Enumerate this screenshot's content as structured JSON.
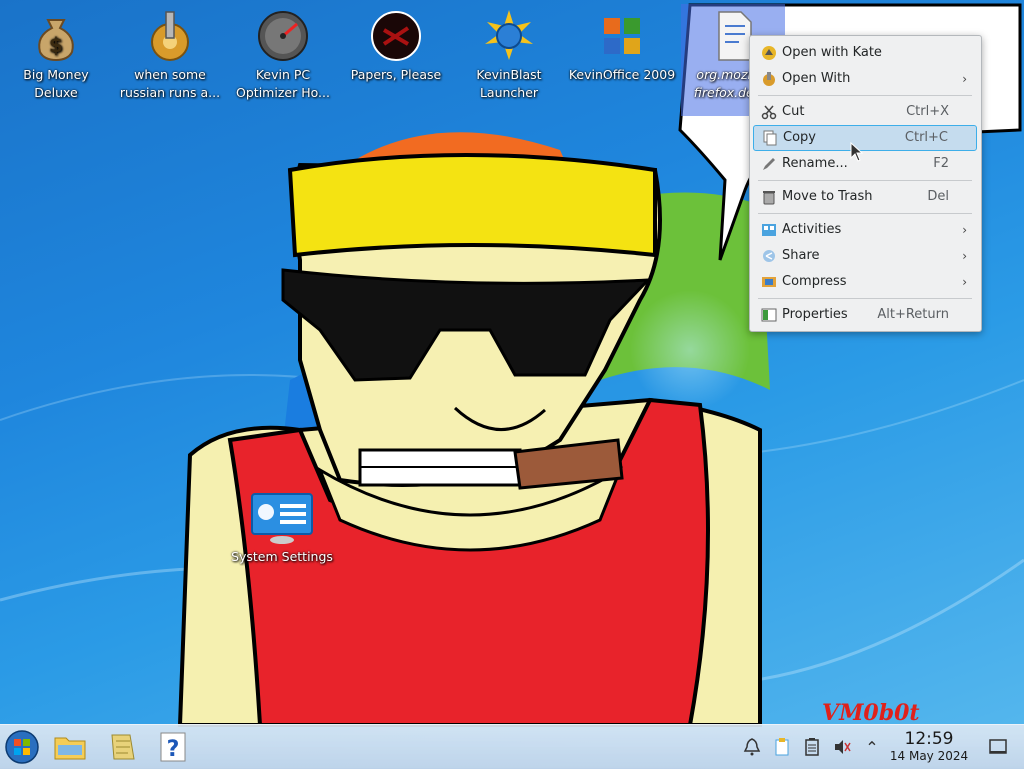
{
  "desktop": {
    "icons": [
      {
        "name": "big-money-deluxe",
        "label": "Big Money Deluxe"
      },
      {
        "name": "russian-runs",
        "label": "when some russian runs a..."
      },
      {
        "name": "kevin-pc-optimizer",
        "label": "Kevin PC Optimizer Ho..."
      },
      {
        "name": "papers-please",
        "label": "Papers, Please"
      },
      {
        "name": "kevinblast-launcher",
        "label": "KevinBlast Launcher"
      },
      {
        "name": "kevinoffice-2009",
        "label": "KevinOffice 2009"
      },
      {
        "name": "firefox-desktop-file",
        "label": "org.mozilla. firefox.des..."
      },
      {
        "name": "system-settings",
        "label": "System Settings"
      }
    ]
  },
  "context_menu": {
    "items": [
      {
        "label": "Open with Kate",
        "shortcut": "",
        "submenu": false
      },
      {
        "label": "Open With",
        "shortcut": "",
        "submenu": true
      },
      {
        "label": "Cut",
        "shortcut": "Ctrl+X",
        "submenu": false
      },
      {
        "label": "Copy",
        "shortcut": "Ctrl+C",
        "submenu": false,
        "highlighted": true
      },
      {
        "label": "Rename...",
        "shortcut": "F2",
        "submenu": false
      },
      {
        "label": "Move to Trash",
        "shortcut": "Del",
        "submenu": false
      },
      {
        "label": "Activities",
        "shortcut": "",
        "submenu": true
      },
      {
        "label": "Share",
        "shortcut": "",
        "submenu": true
      },
      {
        "label": "Compress",
        "shortcut": "",
        "submenu": true
      },
      {
        "label": "Properties",
        "shortcut": "Alt+Return",
        "submenu": false
      }
    ],
    "submenu_arrow": "›"
  },
  "taskbar": {
    "launchers": [
      "start-orb-icon",
      "file-manager-icon",
      "notes-icon",
      "help-icon"
    ],
    "tray": [
      "notifications-icon",
      "clipboard-icon",
      "battery-icon",
      "volume-muted-icon",
      "expand-tray-icon"
    ],
    "expand_glyph": "⌃",
    "clock": {
      "time": "12:59",
      "date": "14 May 2024"
    },
    "show_desktop": "show-desktop-icon"
  },
  "watermark": "VM0b0t",
  "colors": {
    "menu_highlight": "#c5dcee",
    "menu_highlight_border": "#3daee9",
    "accent": "#3daee9"
  }
}
